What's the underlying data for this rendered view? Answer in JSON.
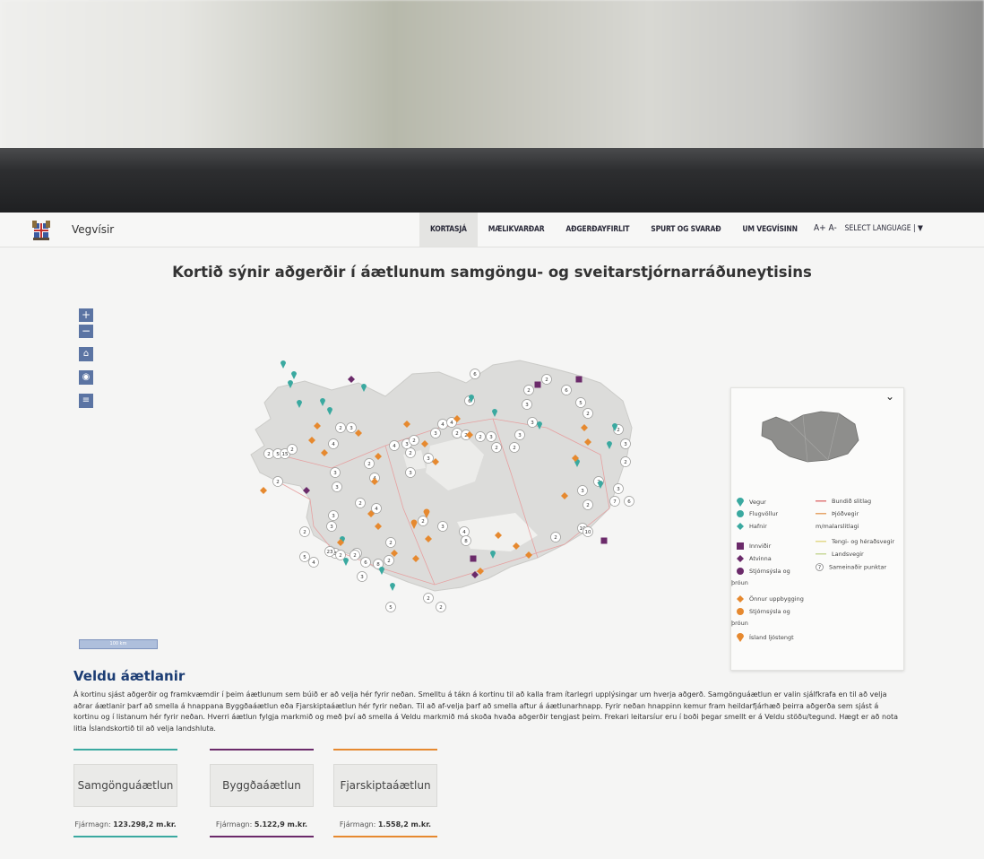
{
  "header": {
    "brand": "Vegvísir",
    "nav": [
      "KORTASJÁ",
      "MÆLIKVARÐAR",
      "AÐGERÐAYFIRLIT",
      "SPURT OG SVARAÐ",
      "UM VEGVÍSINN"
    ],
    "font_tools": "A+ A-",
    "language": "SELECT LANGUAGE | ▼"
  },
  "page": {
    "title": "Kortið sýnir aðgerðir í áætlunum samgöngu- og sveitarstjórnarráðuneytisins"
  },
  "map_controls": {
    "zoom_in": "+",
    "zoom_out": "−"
  },
  "scale_label": "100 km",
  "legend": {
    "items": [
      {
        "label": "Vegur"
      },
      {
        "label": "Flugvöllur"
      },
      {
        "label": "Hafnir"
      },
      {
        "label": "Innviðir"
      },
      {
        "label": "Atvinna"
      },
      {
        "label": "Stjórnsýsla og"
      },
      {
        "label": "þróun"
      },
      {
        "label": "Önnur uppbygging"
      },
      {
        "label": "Stjórnsýsla og"
      },
      {
        "label": "þróun"
      },
      {
        "label": "Ísland ljóstengt"
      }
    ],
    "lines": [
      {
        "label": "Bundið slitlag"
      },
      {
        "label": "Þjóðvegir"
      },
      {
        "label": "m/malarslitlagi"
      },
      {
        "label": "Tengi- og héraðsvegir"
      },
      {
        "label": "Landsvegir"
      },
      {
        "label": "Sameinaðir punktar"
      }
    ],
    "cluster_number": "7"
  },
  "section": {
    "title": "Veldu áætlanir",
    "intro": "Á kortinu sjást aðgerðir og framkvæmdir í þeim áætlunum sem búið er að velja hér fyrir neðan. Smelltu á tákn á kortinu til að kalla fram ítarlegri upplýsingar um hverja aðgerð. Samgönguáætlun er valin sjálfkrafa en til að velja aðrar áætlanir þarf að smella á hnappana Byggðaáætlun eða Fjarskiptaáætlun hér fyrir neðan. Til að af-velja þarf að smella aftur á áætlunarhnapp. Fyrir neðan hnappinn kemur fram heildarfjárhæð þeirra aðgerða sem sjást á kortinu og í listanum hér fyrir neðan. Hverri áætlun fylgja markmið og með því að smella á Veldu markmið má skoða hvaða aðgerðir tengjast þeim. Frekari leitarsíur eru í boði þegar smellt er á Veldu stöðu/tegund. Hægt er að nota litla Íslandskortið til að velja landshluta."
  },
  "plans": [
    {
      "label": "Samgönguáætlun",
      "fund_label": "Fjármagn:",
      "fund_value": "123.298,2 m.kr.",
      "color": "#3aa9a0"
    },
    {
      "label": "Byggðaáætlun",
      "fund_label": "Fjármagn:",
      "fund_value": "5.122,9 m.kr.",
      "color": "#6b2a6a"
    },
    {
      "label": "Fjarskiptaáætlun",
      "fund_label": "Fjármagn:",
      "fund_value": "1.558,2 m.kr.",
      "color": "#e6892f"
    }
  ],
  "map": {
    "clusters": [
      "6",
      "2",
      "2",
      "6",
      "3",
      "5",
      "2",
      "3",
      "3",
      "10",
      "2",
      "2",
      "3",
      "2",
      "3",
      "7",
      "6",
      "2",
      "3",
      "2",
      "2",
      "5",
      "15",
      "2",
      "4",
      "2",
      "3",
      "3",
      "3",
      "3",
      "2",
      "3",
      "3",
      "3",
      "4",
      "2",
      "4",
      "2",
      "3",
      "4",
      "3",
      "3",
      "4",
      "4",
      "2",
      "2",
      "2",
      "4",
      "8",
      "3",
      "2",
      "2",
      "3",
      "2",
      "2",
      "3",
      "5",
      "4",
      "23",
      "2",
      "2",
      "6",
      "8",
      "2",
      "3",
      "2",
      "6",
      "2",
      "2",
      "10",
      "5",
      "2",
      "2"
    ]
  },
  "colors": {
    "teal": "#3aa9a0",
    "purple": "#6b2a6a",
    "orange": "#e6892f",
    "accent": "#5b74a3",
    "title_blue": "#1c3d74"
  }
}
